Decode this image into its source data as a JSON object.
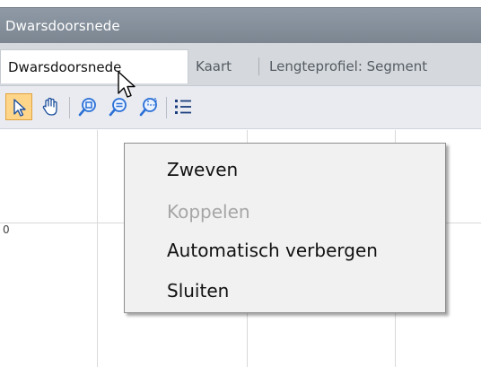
{
  "window": {
    "title": "Dwarsdoorsnede"
  },
  "tabs": [
    {
      "label": "Dwarsdoorsnede",
      "active": true
    },
    {
      "label": "Kaart",
      "active": false
    },
    {
      "label": "Lengteprofiel: Segment",
      "active": false
    }
  ],
  "toolbar": {
    "buttons": [
      {
        "icon": "select-arrow-icon",
        "active": true
      },
      {
        "icon": "pan-hand-icon",
        "active": false
      },
      {
        "icon": "zoom-in-icon",
        "active": false
      },
      {
        "icon": "zoom-out-icon",
        "active": false
      },
      {
        "icon": "zoom-extent-icon",
        "active": false
      },
      {
        "icon": "legend-list-icon",
        "active": false
      }
    ]
  },
  "canvas": {
    "axis_label": "0"
  },
  "context_menu": {
    "items": [
      {
        "label": "Zweven",
        "enabled": true
      },
      {
        "label": "Koppelen",
        "enabled": false
      },
      {
        "label": "Automatisch verbergen",
        "enabled": true
      },
      {
        "label": "Sluiten",
        "enabled": true
      }
    ]
  },
  "colors": {
    "titlebar": "#7f8a95",
    "tabstrip": "#d5d9de",
    "toolbar": "#e9ebf1",
    "active_tool": "#ffd58a",
    "menu_bg": "#f1f1f1",
    "disabled_text": "#a6a6a6"
  }
}
